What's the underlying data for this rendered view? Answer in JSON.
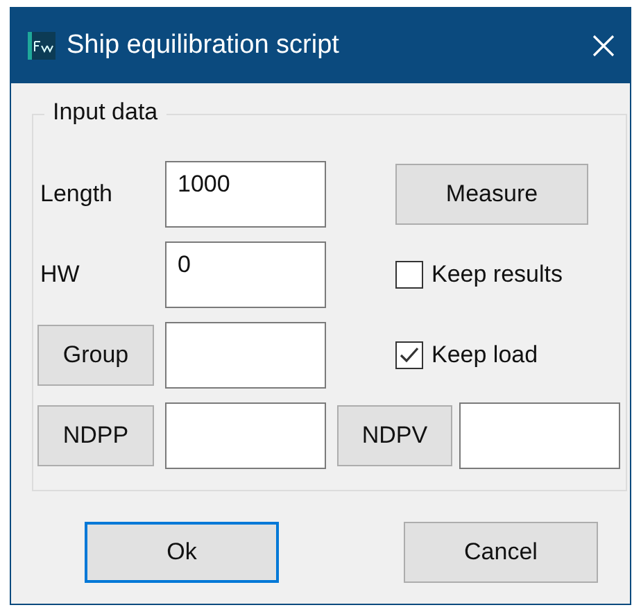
{
  "window": {
    "title": "Ship equilibration script"
  },
  "group": {
    "title": "Input data"
  },
  "fields": [
    {
      "kind": "label",
      "label": "Length",
      "value": "1000"
    },
    {
      "kind": "label",
      "label": "HW",
      "value": "0"
    },
    {
      "kind": "button",
      "label": "Group"
    },
    {
      "kind": "button",
      "label": "NDPP"
    }
  ],
  "side": [
    {
      "kind": "button",
      "label": "Measure"
    },
    {
      "kind": "checkbox",
      "label": "Keep results",
      "checked": false
    },
    {
      "kind": "checkbox",
      "label": "Keep load",
      "checked": true
    },
    {
      "kind": "buttonfield",
      "label": "NDPV"
    }
  ],
  "buttons": [
    {
      "label": "Ok",
      "focused": true
    },
    {
      "label": "Cancel",
      "focused": false
    }
  ]
}
